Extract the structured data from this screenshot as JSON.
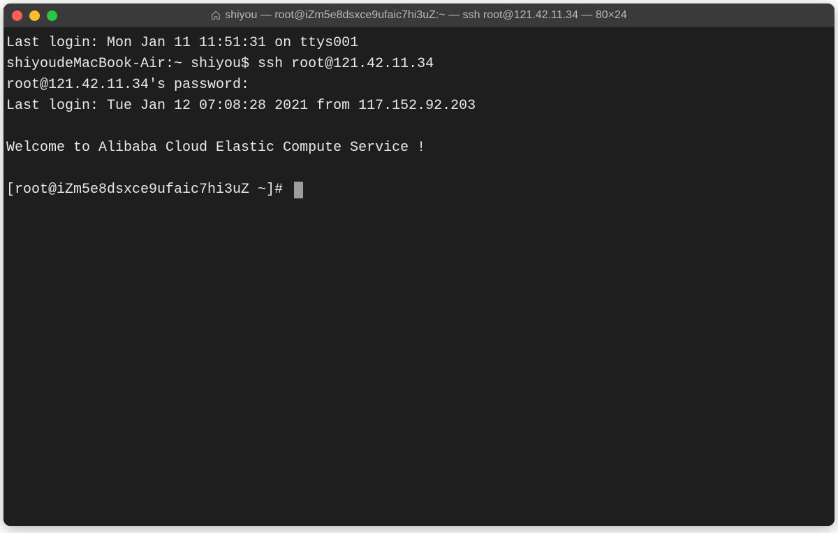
{
  "window": {
    "title": "shiyou — root@iZm5e8dsxce9ufaic7hi3uZ:~ — ssh root@121.42.11.34 — 80×24",
    "home_icon": "home-icon"
  },
  "terminal": {
    "lines": [
      "Last login: Mon Jan 11 11:51:31 on ttys001",
      "shiyoudeMacBook-Air:~ shiyou$ ssh root@121.42.11.34",
      "root@121.42.11.34's password:",
      "Last login: Tue Jan 12 07:08:28 2021 from 117.152.92.203",
      "",
      "Welcome to Alibaba Cloud Elastic Compute Service !",
      "",
      "[root@iZm5e8dsxce9ufaic7hi3uZ ~]# "
    ]
  }
}
